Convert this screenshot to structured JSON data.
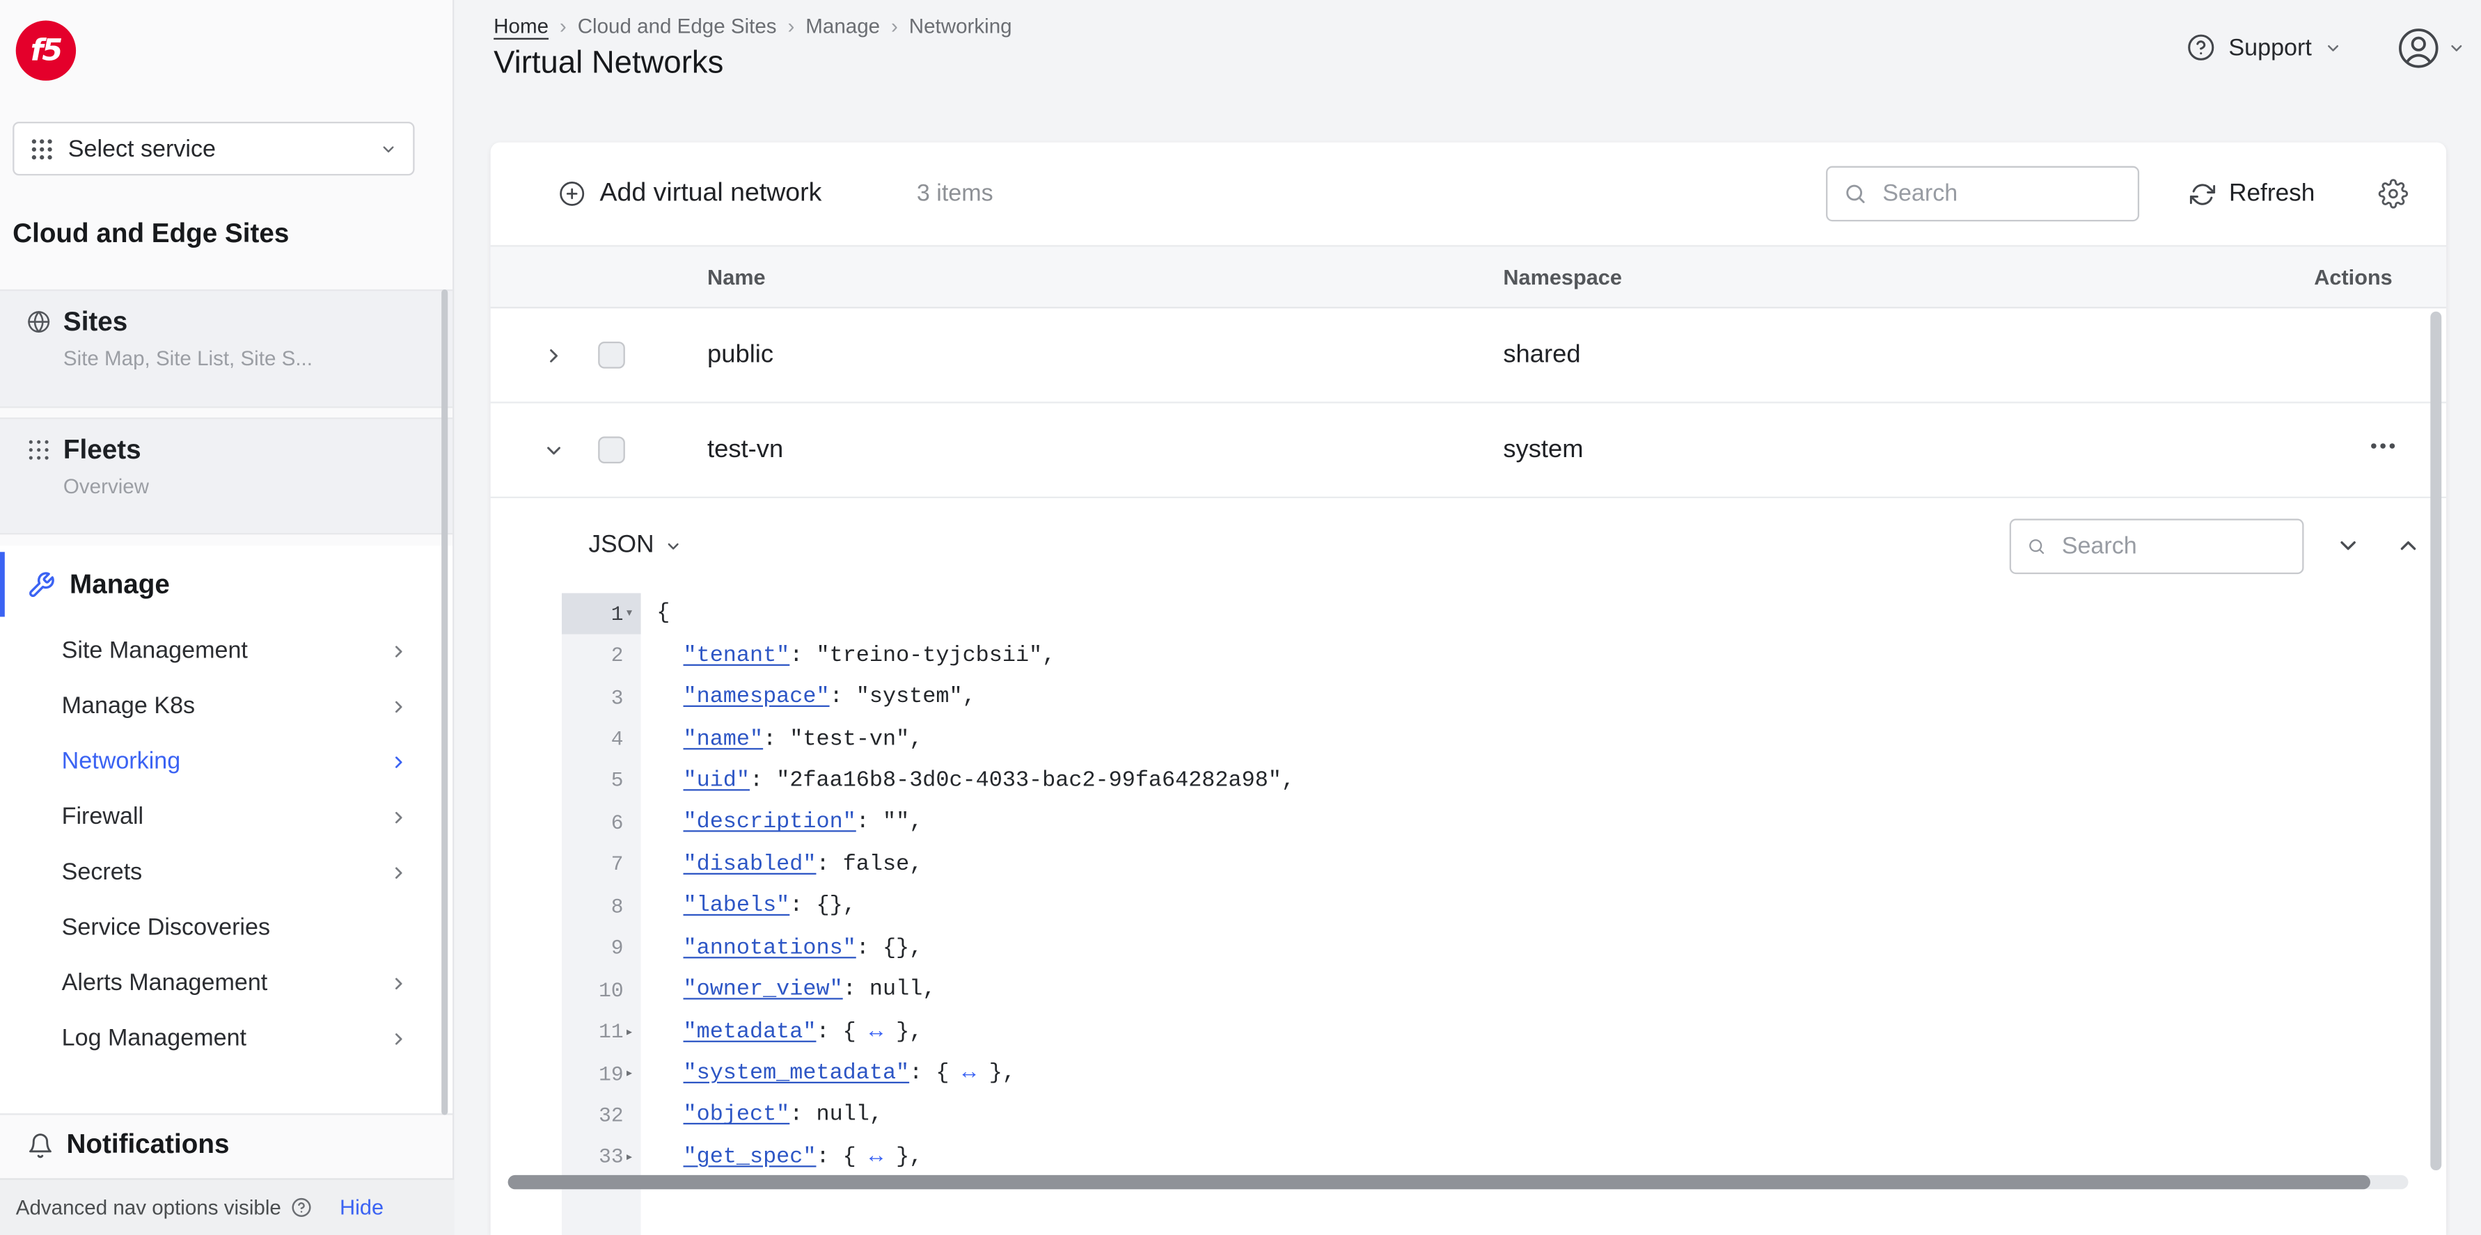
{
  "colors": {
    "accent": "#3b63f3",
    "logo_red": "#e4002b"
  },
  "sidebar": {
    "logo_text": "f5",
    "service_selector": {
      "label": "Select service"
    },
    "title": "Cloud and Edge Sites",
    "groups": [
      {
        "label": "Sites",
        "subtitle": "Site Map, Site List, Site S..."
      },
      {
        "label": "Fleets",
        "subtitle": "Overview"
      }
    ],
    "manage": {
      "label": "Manage"
    },
    "manage_items": [
      {
        "label": "Site Management"
      },
      {
        "label": "Manage K8s"
      },
      {
        "label": "Networking"
      },
      {
        "label": "Firewall"
      },
      {
        "label": "Secrets"
      },
      {
        "label": "Service Discoveries"
      },
      {
        "label": "Alerts Management"
      },
      {
        "label": "Log Management"
      }
    ],
    "notifications_label": "Notifications",
    "footer": {
      "text": "Advanced nav options visible",
      "hide": "Hide"
    }
  },
  "header": {
    "breadcrumbs": [
      "Home",
      "Cloud and Edge Sites",
      "Manage",
      "Networking"
    ],
    "separator": "›",
    "title": "Virtual Networks",
    "support": "Support"
  },
  "toolbar": {
    "add": "Add virtual network",
    "count": "3 items",
    "search_placeholder": "Search",
    "refresh": "Refresh"
  },
  "table": {
    "columns": [
      "Name",
      "Namespace",
      "Actions"
    ],
    "rows": [
      {
        "name": "public",
        "namespace": "shared",
        "expanded": false
      },
      {
        "name": "test-vn",
        "namespace": "system",
        "expanded": true
      }
    ]
  },
  "viewer": {
    "mode": "JSON",
    "search_placeholder": "Search",
    "lines": [
      {
        "n": "1",
        "fold": "open",
        "sel": true,
        "seg": [
          [
            "p",
            "{"
          ]
        ]
      },
      {
        "n": "2",
        "seg": [
          [
            "p",
            "  "
          ],
          [
            "k",
            "\"tenant\""
          ],
          [
            "p",
            ": "
          ],
          [
            "v",
            "\"treino-tyjcbsii\""
          ],
          [
            "p",
            ","
          ]
        ]
      },
      {
        "n": "3",
        "seg": [
          [
            "p",
            "  "
          ],
          [
            "k",
            "\"namespace\""
          ],
          [
            "p",
            ": "
          ],
          [
            "v",
            "\"system\""
          ],
          [
            "p",
            ","
          ]
        ]
      },
      {
        "n": "4",
        "seg": [
          [
            "p",
            "  "
          ],
          [
            "k",
            "\"name\""
          ],
          [
            "p",
            ": "
          ],
          [
            "v",
            "\"test-vn\""
          ],
          [
            "p",
            ","
          ]
        ]
      },
      {
        "n": "5",
        "seg": [
          [
            "p",
            "  "
          ],
          [
            "k",
            "\"uid\""
          ],
          [
            "p",
            ": "
          ],
          [
            "v",
            "\"2faa16b8-3d0c-4033-bac2-99fa64282a98\""
          ],
          [
            "p",
            ","
          ]
        ]
      },
      {
        "n": "6",
        "seg": [
          [
            "p",
            "  "
          ],
          [
            "k",
            "\"description\""
          ],
          [
            "p",
            ": "
          ],
          [
            "v",
            "\"\""
          ],
          [
            "p",
            ","
          ]
        ]
      },
      {
        "n": "7",
        "seg": [
          [
            "p",
            "  "
          ],
          [
            "k",
            "\"disabled\""
          ],
          [
            "p",
            ": "
          ],
          [
            "w",
            "false"
          ],
          [
            "p",
            ","
          ]
        ]
      },
      {
        "n": "8",
        "seg": [
          [
            "p",
            "  "
          ],
          [
            "k",
            "\"labels\""
          ],
          [
            "p",
            ": {},"
          ]
        ]
      },
      {
        "n": "9",
        "seg": [
          [
            "p",
            "  "
          ],
          [
            "k",
            "\"annotations\""
          ],
          [
            "p",
            ": {},"
          ]
        ]
      },
      {
        "n": "10",
        "seg": [
          [
            "p",
            "  "
          ],
          [
            "k",
            "\"owner_view\""
          ],
          [
            "p",
            ": "
          ],
          [
            "w",
            "null"
          ],
          [
            "p",
            ","
          ]
        ]
      },
      {
        "n": "11",
        "fold": "closed",
        "seg": [
          [
            "p",
            "  "
          ],
          [
            "k",
            "\"metadata\""
          ],
          [
            "p",
            ": { "
          ],
          [
            "a",
            "↔"
          ],
          [
            "p",
            " },"
          ]
        ]
      },
      {
        "n": "19",
        "fold": "closed",
        "seg": [
          [
            "p",
            "  "
          ],
          [
            "k",
            "\"system_metadata\""
          ],
          [
            "p",
            ": { "
          ],
          [
            "a",
            "↔"
          ],
          [
            "p",
            " },"
          ]
        ]
      },
      {
        "n": "32",
        "seg": [
          [
            "p",
            "  "
          ],
          [
            "k",
            "\"object\""
          ],
          [
            "p",
            ": "
          ],
          [
            "w",
            "null"
          ],
          [
            "p",
            ","
          ]
        ]
      },
      {
        "n": "33",
        "fold": "closed",
        "seg": [
          [
            "p",
            "  "
          ],
          [
            "k",
            "\"get_spec\""
          ],
          [
            "p",
            ": { "
          ],
          [
            "a",
            "↔"
          ],
          [
            "p",
            " },"
          ]
        ]
      }
    ]
  }
}
